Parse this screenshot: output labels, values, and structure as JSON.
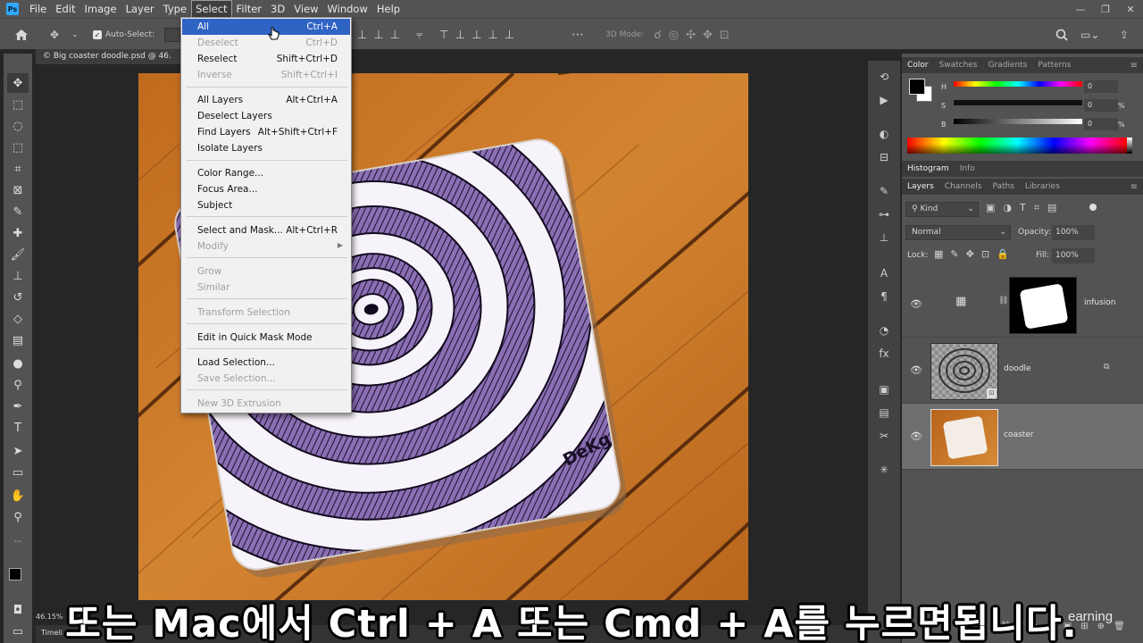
{
  "menubar": {
    "logo": "Ps",
    "items": [
      "File",
      "Edit",
      "Image",
      "Layer",
      "Type",
      "Select",
      "Filter",
      "3D",
      "View",
      "Window",
      "Help"
    ],
    "active": "Select"
  },
  "options": {
    "auto_select_label": "Auto-Select:",
    "auto_select_checked": true,
    "mode_3d": "3D Mode:"
  },
  "document": {
    "tab_title": "© Big coaster doodle.psd @ 46.",
    "zoom": "46.15%",
    "timeline_label": "Timeli",
    "coaster_signature": "DeKg"
  },
  "select_menu": {
    "items": [
      {
        "label": "All",
        "shortcut": "Ctrl+A",
        "state": "highlighted"
      },
      {
        "label": "Deselect",
        "shortcut": "Ctrl+D",
        "state": "disabled"
      },
      {
        "label": "Reselect",
        "shortcut": "Shift+Ctrl+D",
        "state": "enabled"
      },
      {
        "label": "Inverse",
        "shortcut": "Shift+Ctrl+I",
        "state": "disabled"
      },
      {
        "label": "All Layers",
        "shortcut": "Alt+Ctrl+A",
        "state": "enabled"
      },
      {
        "label": "Deselect Layers",
        "shortcut": "",
        "state": "enabled"
      },
      {
        "label": "Find Layers",
        "shortcut": "Alt+Shift+Ctrl+F",
        "state": "enabled"
      },
      {
        "label": "Isolate Layers",
        "shortcut": "",
        "state": "enabled"
      },
      {
        "label": "Color Range...",
        "shortcut": "",
        "state": "enabled"
      },
      {
        "label": "Focus Area...",
        "shortcut": "",
        "state": "enabled"
      },
      {
        "label": "Subject",
        "shortcut": "",
        "state": "enabled"
      },
      {
        "label": "Select and Mask...",
        "shortcut": "Alt+Ctrl+R",
        "state": "enabled"
      },
      {
        "label": "Modify",
        "shortcut": "",
        "state": "disabled",
        "submenu": true
      },
      {
        "label": "Grow",
        "shortcut": "",
        "state": "disabled"
      },
      {
        "label": "Similar",
        "shortcut": "",
        "state": "disabled"
      },
      {
        "label": "Transform Selection",
        "shortcut": "",
        "state": "disabled"
      },
      {
        "label": "Edit in Quick Mask Mode",
        "shortcut": "",
        "state": "enabled"
      },
      {
        "label": "Load Selection...",
        "shortcut": "",
        "state": "enabled"
      },
      {
        "label": "Save Selection...",
        "shortcut": "",
        "state": "disabled"
      },
      {
        "label": "New 3D Extrusion",
        "shortcut": "",
        "state": "disabled"
      }
    ]
  },
  "color_panel": {
    "tabs": [
      "Color",
      "Swatches",
      "Gradients",
      "Patterns"
    ],
    "active_tab": "Color",
    "sliders": [
      {
        "label": "H",
        "value": "0",
        "unit": ""
      },
      {
        "label": "S",
        "value": "0",
        "unit": "%"
      },
      {
        "label": "B",
        "value": "0",
        "unit": "%"
      }
    ],
    "foreground": "#000000",
    "background": "#ffffff"
  },
  "histogram_tabs": [
    "Histogram",
    "Info"
  ],
  "layers_panel": {
    "tabs": [
      "Layers",
      "Channels",
      "Paths",
      "Libraries"
    ],
    "active_tab": "Layers",
    "filter_kind": "Kind",
    "blend_mode": "Normal",
    "opacity_label": "Opacity:",
    "opacity": "100%",
    "lock_label": "Lock:",
    "fill_label": "Fill:",
    "fill": "100%",
    "layers": [
      {
        "name": "infusion",
        "type": "adjustment-mask",
        "selected": false
      },
      {
        "name": "doodle",
        "type": "smart-object",
        "selected": false
      },
      {
        "name": "coaster",
        "type": "image",
        "selected": true
      }
    ]
  },
  "subtitle": "또는 Mac에서 Ctrl + A 또는 Cmd + A를 누르면됩니다.",
  "watermark": "earning"
}
